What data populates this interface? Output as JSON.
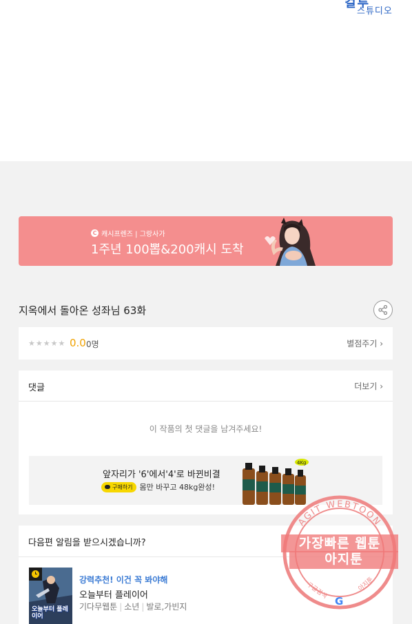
{
  "header": {
    "logo_big": "컬투",
    "logo_small": "스튜디오"
  },
  "banner": {
    "small_text": "캐시프렌즈 | 그랑사가",
    "headline": "1주년 100뽑&200캐시 도착",
    "c_icon": "C"
  },
  "episode": {
    "title": "지옥에서 돌아온 성좌님 63화"
  },
  "rating": {
    "stars": [
      "★",
      "★",
      "★",
      "★",
      "★"
    ],
    "score": "0.0",
    "count": "0명",
    "rate_link": "별점주기 ›"
  },
  "comments": {
    "title": "댓글",
    "more": "더보기 ›",
    "empty_message": "이 작품의 첫 댓글을 남겨주세요!"
  },
  "ad": {
    "headline": "앞자리가 '6'에서'4'로 바뀐비결",
    "button": "구매하기",
    "subtext": "몸만 바꾸고 48kg완성!",
    "bottle_tag": "4Kg"
  },
  "notify": {
    "title": "다음편 알림을 받으시겠습니까?"
  },
  "recommendation": {
    "label": "강력추천! 이건 꼭 봐야해",
    "title": "오늘부터 플레이어",
    "thumb_text": "오늘부터 플레이어",
    "meta": [
      "기다무웹툰",
      "소년",
      "발로,가빈지"
    ]
  },
  "stamp": {
    "ring_text": "AGIT WEBTOON",
    "line1": "가장빠른 웹툰",
    "line2": "아지툰",
    "bottom_left": "구글검색",
    "bottom_right": "아지툰",
    "google_letter": "G"
  }
}
